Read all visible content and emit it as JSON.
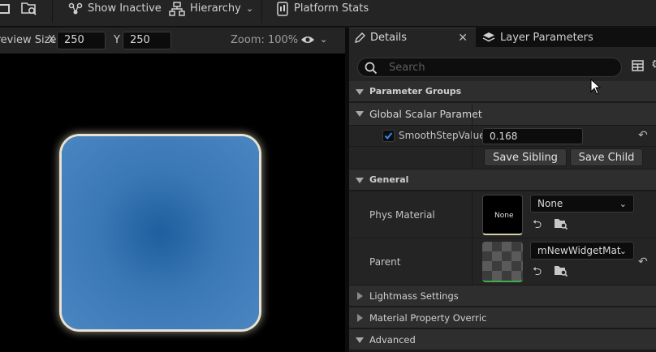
{
  "toolbar": {
    "show_inactive": "Show Inactive",
    "hierarchy": "Hierarchy",
    "platform_stats": "Platform Stats"
  },
  "viewport": {
    "preview_size_label": "Preview Size",
    "x_label": "X",
    "x_value": "250",
    "y_label": "Y",
    "y_value": "250",
    "zoom": "Zoom: 100%"
  },
  "tabs": {
    "details": "Details",
    "layer_parameters": "Layer Parameters"
  },
  "search": {
    "placeholder": "Search"
  },
  "parameter_groups": {
    "title": "Parameter Groups",
    "global_scalar": "Global Scalar Paramet",
    "smoothstep_label": "SmoothStepValue",
    "smoothstep_value": "0.168",
    "save_sibling": "Save Sibling",
    "save_child": "Save Child"
  },
  "general": {
    "title": "General",
    "phys_material_label": "Phys Material",
    "phys_thumb_text": "None",
    "phys_material_value": "None",
    "parent_label": "Parent",
    "parent_value": "mNewWidgetMat"
  },
  "collapsed": {
    "lightmass": "Lightmass Settings",
    "material_property": "Material Property Overric",
    "advanced": "Advanced"
  },
  "colors": {
    "accent_blue": "#1a5fb4",
    "panel": "#242424",
    "preview_blue": "#3a77b5"
  }
}
